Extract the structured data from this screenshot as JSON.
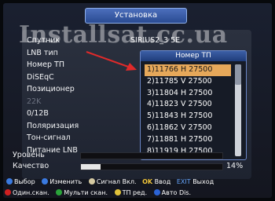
{
  "window_title": "Установка",
  "watermark": "Installsat.cc.ua",
  "menu": {
    "satellite_label": "Спутник",
    "satellite_value": "SIRIUS2_3  5E",
    "items": [
      "LNB тип",
      "Номер ТП",
      "DiSEqC",
      "Позиционер",
      "22K",
      "0/12В",
      "Поляризация",
      "Тон-сигнал",
      "Питание LNB"
    ]
  },
  "popup": {
    "title": "Номер ТП",
    "selected_index": 0,
    "scroll_position": 0.0,
    "items": [
      "1)11766  H  27500",
      "2)11785  V  27500",
      "3)11804  H  27500",
      "4)11823  V  27500",
      "5)11843  H  27500",
      "6)11862  V  27500",
      "7)11881  H  27500",
      "8)11919  H  27500"
    ]
  },
  "meters": {
    "level_label": "Уровень",
    "level_value": 0.0,
    "quality_label": "Качество",
    "quality_value": 0.14,
    "quality_text": "14%"
  },
  "hints": {
    "select": "Выбор",
    "change": "Изменить",
    "signal": "Сигнал",
    "on": "Вкл.",
    "ok": "OK",
    "enter": "Ввод",
    "exit": "EXIT",
    "exit_label": "Выход"
  },
  "function_keys": [
    {
      "label": "Один.скан.",
      "color": "#d02020"
    },
    {
      "label": "Мульти скан.",
      "color": "#2aa33a"
    },
    {
      "label": "ТП ред.",
      "color": "#e0c23a"
    },
    {
      "label": "Авто Dis.",
      "color": "#2b63d6"
    }
  ],
  "colors": {
    "accent": "#3c5fa6",
    "selected": "#e6a85a"
  }
}
